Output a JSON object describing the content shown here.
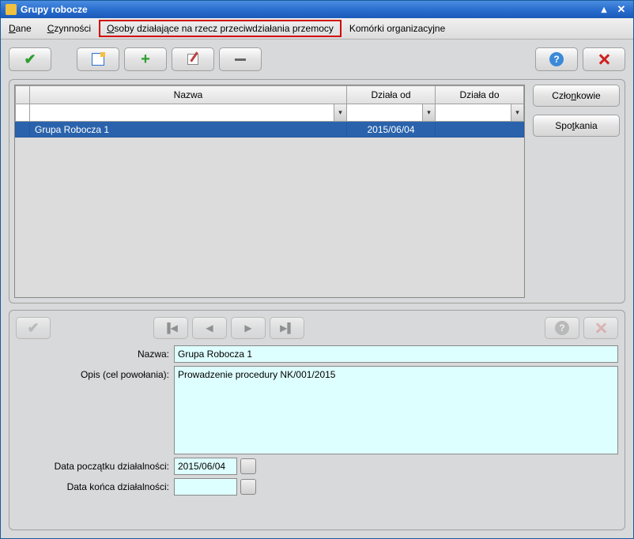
{
  "titlebar": {
    "title": "Grupy robocze"
  },
  "menubar": {
    "dane_prefix": "D",
    "dane_rest": "ane",
    "czynnosci_prefix": "C",
    "czynnosci_rest": "zynności",
    "osoby_prefix": "O",
    "osoby_rest": "soby działające na rzecz przeciwdziałania przemocy",
    "komorki": "Komórki organizacyjne"
  },
  "table": {
    "headers": {
      "name": "Nazwa",
      "from": "Działa od",
      "to": "Działa do"
    },
    "rows": [
      {
        "name": "Grupa Robocza 1",
        "from": "2015/06/04",
        "to": ""
      }
    ]
  },
  "sidebar": {
    "members_prefix": "Czło",
    "members_u": "n",
    "members_rest": "kowie",
    "meetings_prefix": "Spo",
    "meetings_u": "t",
    "meetings_rest": "kania"
  },
  "form": {
    "name_label": "Nazwa:",
    "name_value": "Grupa Robocza 1",
    "opis_label": "Opis (cel powołania):",
    "opis_value": "Prowadzenie procedury NK/001/2015",
    "start_label": "Data początku działalności:",
    "start_value": "2015/06/04",
    "end_label": "Data końca działalności:",
    "end_value": ""
  },
  "icons": {
    "help": "?"
  },
  "nav_glyphs": {
    "first": "▐◀",
    "prev": "◀",
    "next": "▶",
    "last": "▶▌"
  },
  "win_glyphs": {
    "max": "▴",
    "close": "✕"
  }
}
